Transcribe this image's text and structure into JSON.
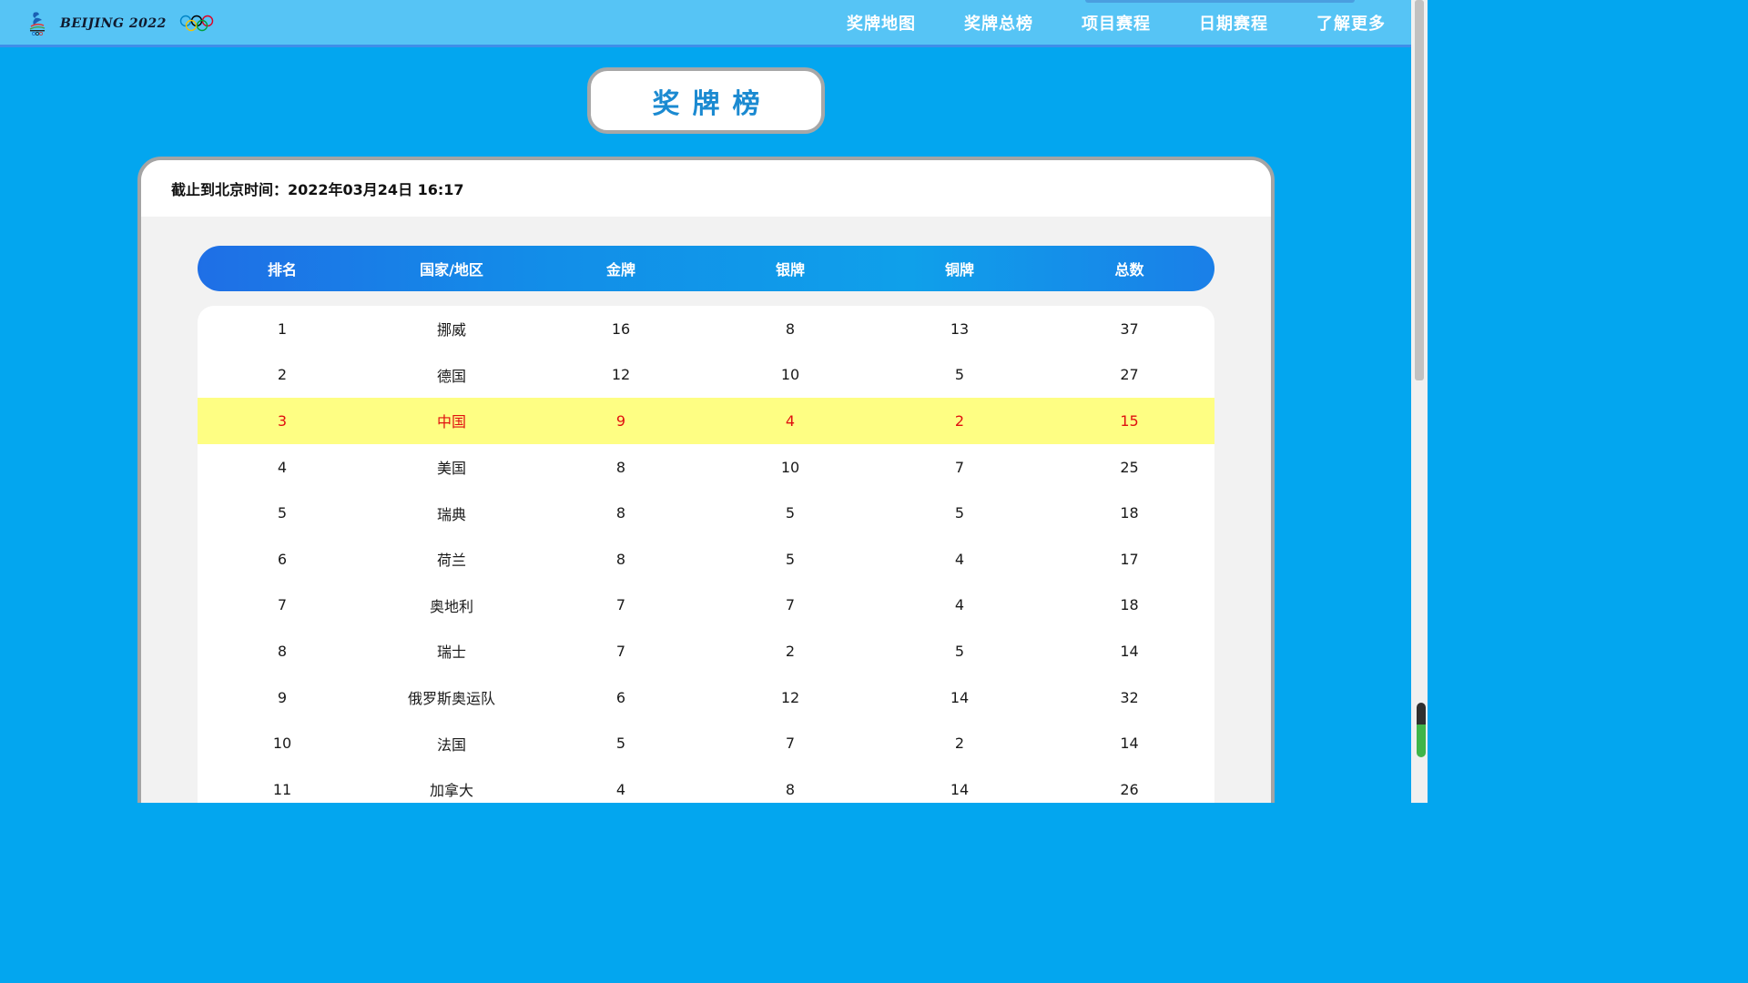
{
  "header": {
    "brand_text": "BEIJING 2022",
    "nav": [
      "奖牌地图",
      "奖牌总榜",
      "项目赛程",
      "日期赛程",
      "了解更多"
    ]
  },
  "title": "奖牌榜",
  "panel": {
    "timestamp": "截止到北京时间：2022年03月24日 16:17",
    "columns": [
      "排名",
      "国家/地区",
      "金牌",
      "银牌",
      "铜牌",
      "总数"
    ],
    "rows": [
      {
        "rank": "1",
        "country": "挪威",
        "gold": "16",
        "silver": "8",
        "bronze": "13",
        "total": "37"
      },
      {
        "rank": "2",
        "country": "德国",
        "gold": "12",
        "silver": "10",
        "bronze": "5",
        "total": "27"
      },
      {
        "rank": "3",
        "country": "中国",
        "gold": "9",
        "silver": "4",
        "bronze": "2",
        "total": "15",
        "highlight": true
      },
      {
        "rank": "4",
        "country": "美国",
        "gold": "8",
        "silver": "10",
        "bronze": "7",
        "total": "25"
      },
      {
        "rank": "5",
        "country": "瑞典",
        "gold": "8",
        "silver": "5",
        "bronze": "5",
        "total": "18"
      },
      {
        "rank": "6",
        "country": "荷兰",
        "gold": "8",
        "silver": "5",
        "bronze": "4",
        "total": "17"
      },
      {
        "rank": "7",
        "country": "奥地利",
        "gold": "7",
        "silver": "7",
        "bronze": "4",
        "total": "18"
      },
      {
        "rank": "8",
        "country": "瑞士",
        "gold": "7",
        "silver": "2",
        "bronze": "5",
        "total": "14"
      },
      {
        "rank": "9",
        "country": "俄罗斯奥运队",
        "gold": "6",
        "silver": "12",
        "bronze": "14",
        "total": "32"
      },
      {
        "rank": "10",
        "country": "法国",
        "gold": "5",
        "silver": "7",
        "bronze": "2",
        "total": "14"
      },
      {
        "rank": "11",
        "country": "加拿大",
        "gold": "4",
        "silver": "8",
        "bronze": "14",
        "total": "26"
      }
    ]
  },
  "colors": {
    "page_bg": "#03a6ef",
    "nav_bg": "#56c4f5",
    "title_text": "#1b8ad1",
    "highlight_row": "#fefe83",
    "highlight_text": "#e01010"
  },
  "icons": [
    "beijing-2022-emblem-icon",
    "olympic-rings-icon"
  ]
}
